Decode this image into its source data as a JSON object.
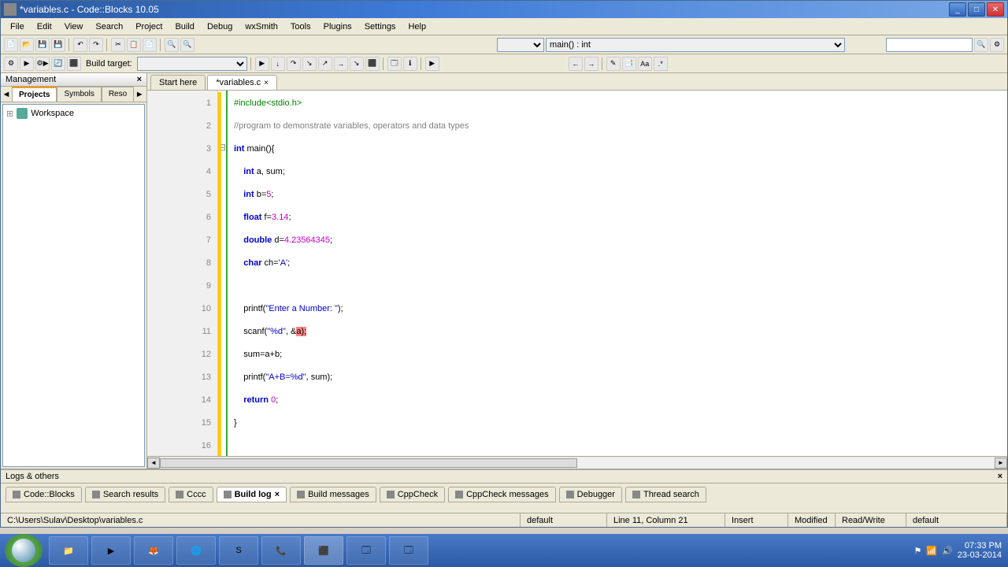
{
  "window": {
    "title": "*variables.c - Code::Blocks 10.05"
  },
  "menu": {
    "items": [
      "File",
      "Edit",
      "View",
      "Search",
      "Project",
      "Build",
      "Debug",
      "wxSmith",
      "Tools",
      "Plugins",
      "Settings",
      "Help"
    ]
  },
  "toolbar2": {
    "build_target_label": "Build target:",
    "scope": "main() : int"
  },
  "management": {
    "title": "Management",
    "tabs": [
      "Projects",
      "Symbols",
      "Reso"
    ],
    "active_tab": 0,
    "workspace": "Workspace"
  },
  "editor": {
    "tabs": [
      {
        "label": "Start here",
        "active": false,
        "closable": false
      },
      {
        "label": "*variables.c",
        "active": true,
        "closable": true
      }
    ]
  },
  "code": {
    "lines": [
      {
        "n": 1,
        "html": "<span class='pp'>#include&lt;stdio.h&gt;</span>"
      },
      {
        "n": 2,
        "html": "<span class='cm'>//program to demonstrate variables, operators and data types</span>"
      },
      {
        "n": 3,
        "html": "<span class='kw'>int</span> main(){"
      },
      {
        "n": 4,
        "html": "    <span class='kw'>int</span> a, sum;"
      },
      {
        "n": 5,
        "html": "    <span class='kw'>int</span> b=<span class='num'>5</span>;"
      },
      {
        "n": 6,
        "html": "    <span class='kw'>float</span> f=<span class='num'>3.14</span>;"
      },
      {
        "n": 7,
        "html": "    <span class='kw'>double</span> d=<span class='num'>4.23564345</span>;"
      },
      {
        "n": 8,
        "html": "    <span class='kw'>char</span> ch=<span class='str'>'A'</span>;"
      },
      {
        "n": 9,
        "html": ""
      },
      {
        "n": 10,
        "html": "    printf(<span class='str'>\"Enter a Number: \"</span>);"
      },
      {
        "n": 11,
        "html": "    scanf(<span class='str'>\"%d\"</span>, &amp;<span class='hl'>a);</span>"
      },
      {
        "n": 12,
        "html": "    sum=a+b;"
      },
      {
        "n": 13,
        "html": "    printf(<span class='str'>\"A+B=%d\"</span>, sum);"
      },
      {
        "n": 14,
        "html": "    <span class='kw'>return</span> <span class='num'>0</span>;"
      },
      {
        "n": 15,
        "html": "}"
      },
      {
        "n": 16,
        "html": ""
      }
    ]
  },
  "logs": {
    "title": "Logs & others",
    "tabs": [
      "Code::Blocks",
      "Search results",
      "Cccc",
      "Build log",
      "Build messages",
      "CppCheck",
      "CppCheck messages",
      "Debugger",
      "Thread search"
    ],
    "active_tab": 3
  },
  "status": {
    "path": "C:\\Users\\Sulav\\Desktop\\variables.c",
    "encoding": "default",
    "position": "Line 11, Column 21",
    "insert": "Insert",
    "modified": "Modified",
    "readwrite": "Read/Write",
    "extra": "default"
  },
  "tray": {
    "time": "07:33 PM",
    "date": "23-03-2014"
  }
}
